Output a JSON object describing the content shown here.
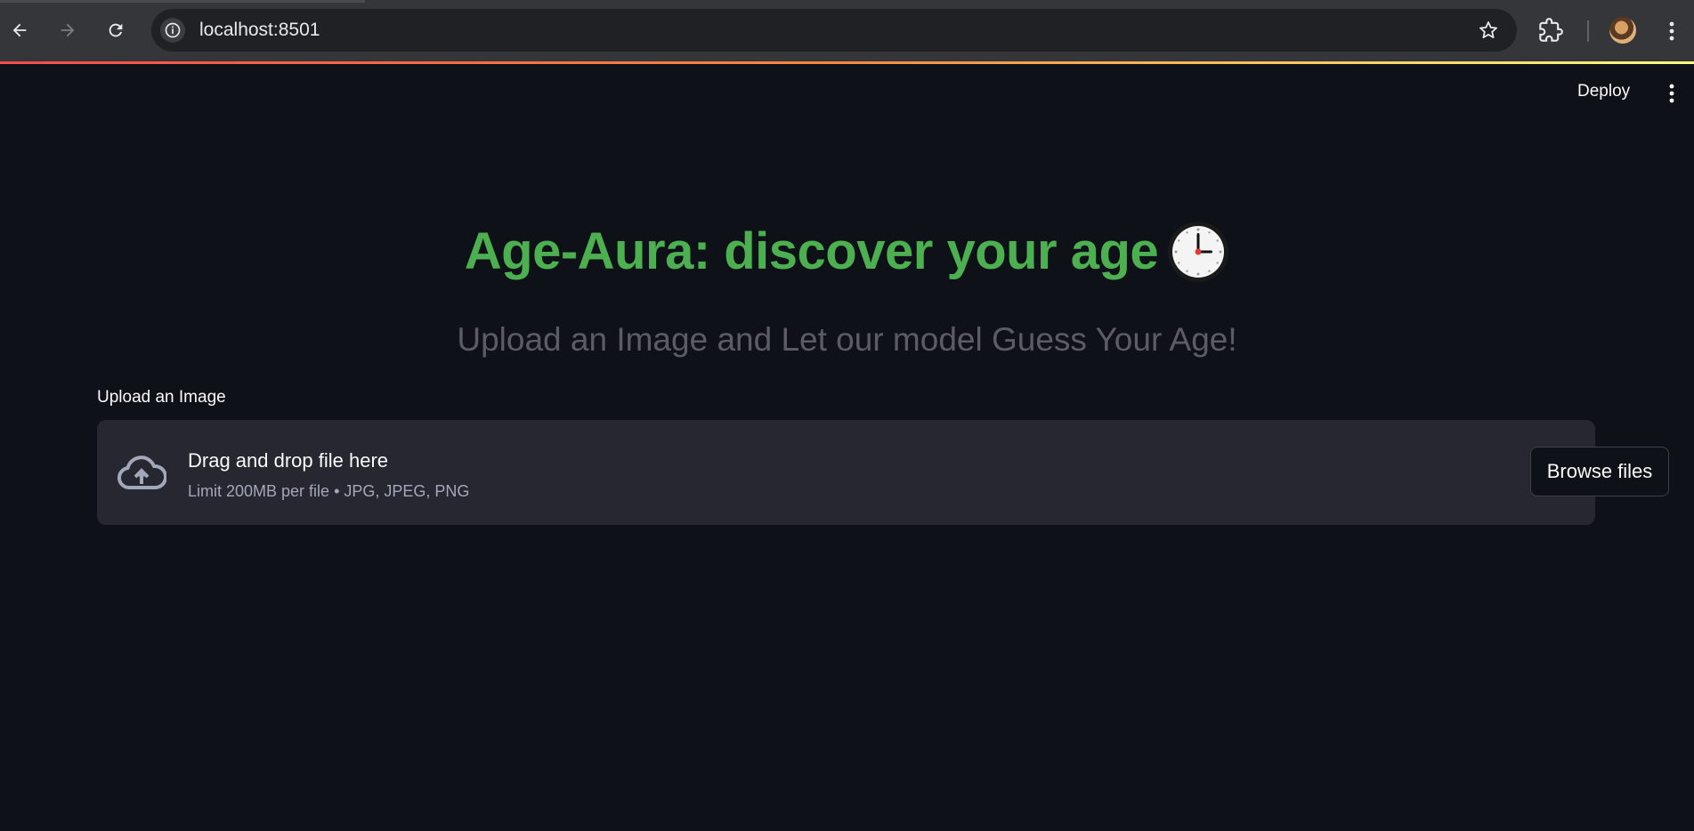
{
  "browser": {
    "url": "localhost:8501",
    "icons": [
      "back-arrow-icon",
      "forward-arrow-icon",
      "reload-icon",
      "site-info-icon",
      "bookmark-star-icon",
      "extensions-icon",
      "profile-avatar",
      "kebab-menu-icon"
    ]
  },
  "app": {
    "header": {
      "deploy_label": "Deploy",
      "menu_icon": "kebab-menu-icon"
    },
    "title": "Age-Aura: discover your age",
    "title_emoji_icon": "clock-icon",
    "subtitle": "Upload an Image and Let our model Guess Your Age!",
    "uploader": {
      "label": "Upload an Image",
      "drop_text": "Drag and drop file here",
      "limit_text": "Limit 200MB per file • JPG, JPEG, PNG",
      "button_label": "Browse files",
      "icon": "cloud-upload-icon"
    },
    "colors": {
      "background": "#0e1117",
      "title_green": "#4caf50",
      "dropzone": "#262730",
      "accent_gradient": [
        "#ff4b4b",
        "#fffd80"
      ]
    }
  }
}
